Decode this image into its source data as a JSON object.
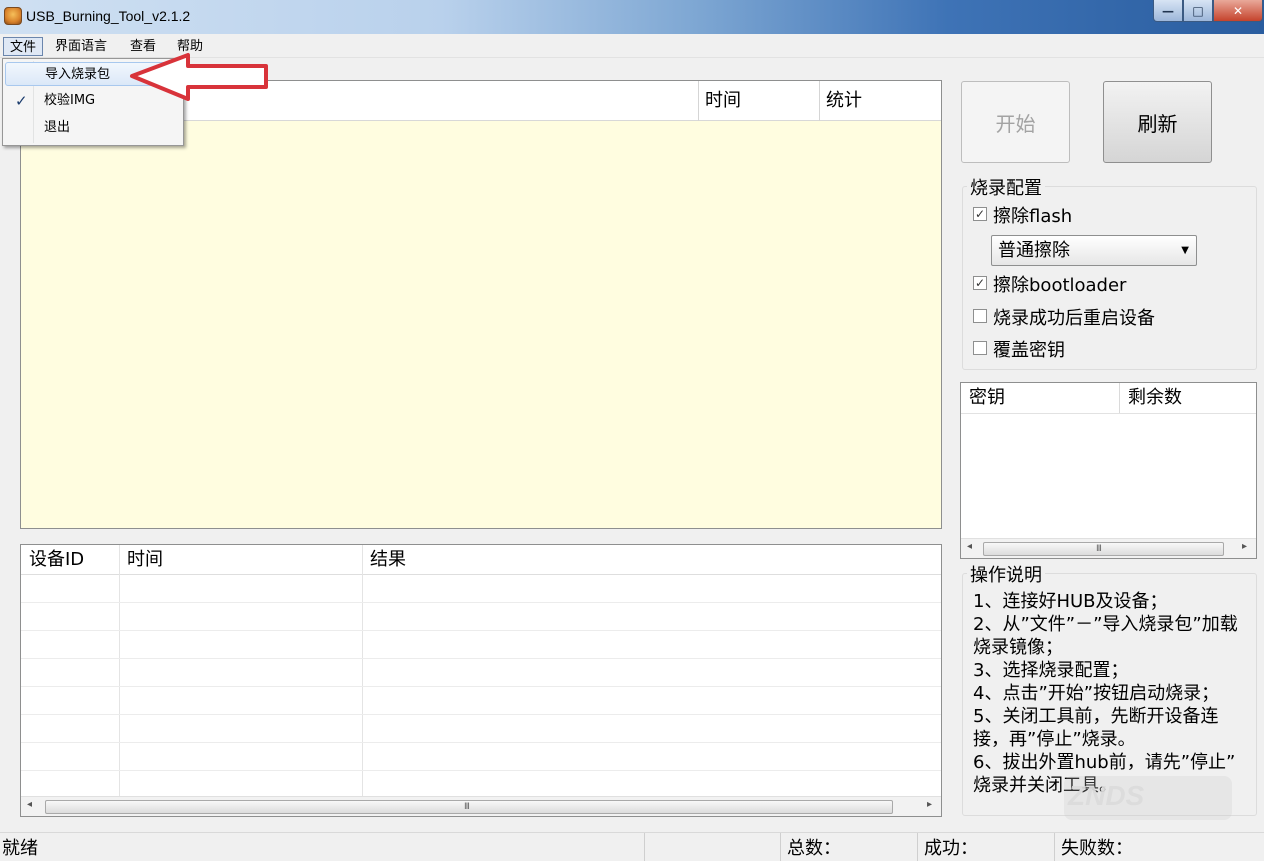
{
  "window": {
    "title": "USB_Burning_Tool_v2.1.2",
    "controls": {
      "minimize": "—",
      "maximize": "□",
      "close": "✕"
    }
  },
  "menubar": {
    "items": [
      "文件",
      "界面语言",
      "查看",
      "帮助"
    ],
    "active_index": 0
  },
  "file_menu": {
    "items": [
      {
        "label": "导入烧录包",
        "checked": false,
        "highlighted": true
      },
      {
        "label": "校验IMG",
        "checked": true,
        "highlighted": false
      },
      {
        "label": "退出",
        "checked": false,
        "highlighted": false
      }
    ],
    "check_glyph": "✓"
  },
  "annotation": {
    "arrow_color": "#d8333a"
  },
  "top_list": {
    "headers": {
      "time": "时间",
      "stats": "统计"
    },
    "background": "#fffde0"
  },
  "device_table": {
    "headers": [
      "设备ID",
      "时间",
      "结果"
    ],
    "scrollbar": {
      "left": "◂",
      "right": "▸",
      "grip": "III"
    }
  },
  "buttons": {
    "start": "开始",
    "refresh": "刷新"
  },
  "burn_config": {
    "title": "烧录配置",
    "erase_flash": {
      "label": "擦除flash",
      "checked": true
    },
    "erase_mode": {
      "value": "普通擦除",
      "arrow": "▼"
    },
    "erase_bootloader": {
      "label": "擦除bootloader",
      "checked": true
    },
    "reboot_after": {
      "label": "烧录成功后重启设备",
      "checked": false
    },
    "overwrite_key": {
      "label": "覆盖密钥",
      "checked": false
    },
    "check_glyph": "✓"
  },
  "key_table": {
    "headers": [
      "密钥",
      "剩余数"
    ],
    "scrollbar": {
      "left": "◂",
      "right": "▸",
      "grip": "III"
    }
  },
  "instructions": {
    "title": "操作说明",
    "lines": [
      "1、连接好HUB及设备；",
      "2、从”文件”－”导入烧录包”加载",
      "烧录镜像；",
      "3、选择烧录配置；",
      "4、点击”开始”按钮启动烧录；",
      "5、关闭工具前，先断开设备连",
      "接，再”停止”烧录。",
      "6、拔出外置hub前，请先”停止”",
      "烧录并关闭工具。"
    ]
  },
  "watermark": {
    "text": "ZNDS"
  },
  "statusbar": {
    "status": "就绪",
    "total": "总数：",
    "success": "成功：",
    "failed": "失败数："
  }
}
